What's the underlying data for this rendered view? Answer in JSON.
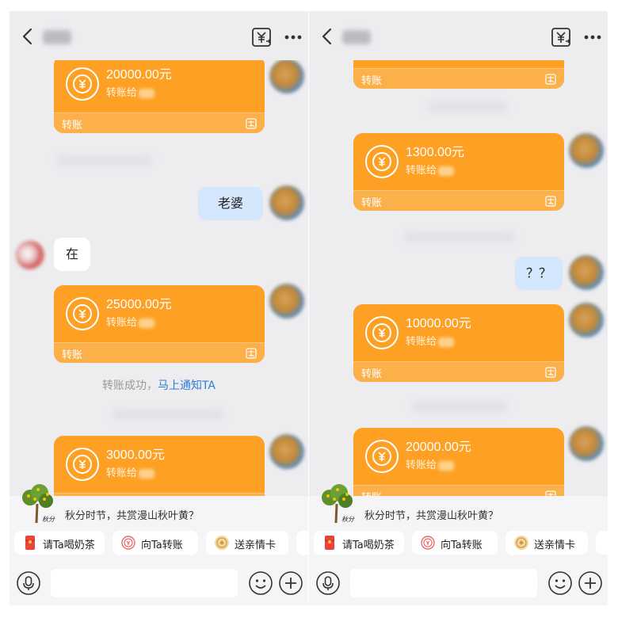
{
  "colors": {
    "card": "#fea024",
    "card_footer": "#fbb04a",
    "blue_bubble": "#d4e7fd",
    "link": "#2f7cd8",
    "background": "#ededf0"
  },
  "left": {
    "card_label": "转账",
    "to_label": "转账给",
    "cards": [
      {
        "amount": "20000.00元"
      },
      {
        "amount": "25000.00元"
      },
      {
        "amount": "3000.00元"
      }
    ],
    "msg_blue": "老婆",
    "msg_white": "在",
    "system_text": "转账成功，",
    "system_link": "马上通知TA"
  },
  "right": {
    "card_label": "转账",
    "to_label": "转账给",
    "top_card_label": "转账",
    "cards": [
      {
        "amount": "1300.00元"
      },
      {
        "amount": "10000.00元"
      },
      {
        "amount": "20000.00元"
      }
    ],
    "msg_blue": "？？"
  },
  "bottom": {
    "tree_caption": "秋分",
    "promo": "秋分时节，共赏漫山秋叶黄？",
    "chips": [
      {
        "label": "请Ta喝奶茶"
      },
      {
        "label": "向Ta转账"
      },
      {
        "label": "送亲情卡"
      }
    ]
  },
  "icons": [
    "back-icon",
    "transfer-icon",
    "more-icon",
    "coin-icon",
    "pay-icon",
    "mic-icon",
    "emoji-icon",
    "plus-icon",
    "red-packet-icon",
    "transfer-chip-icon",
    "card-chip-icon",
    "tree-icon"
  ]
}
